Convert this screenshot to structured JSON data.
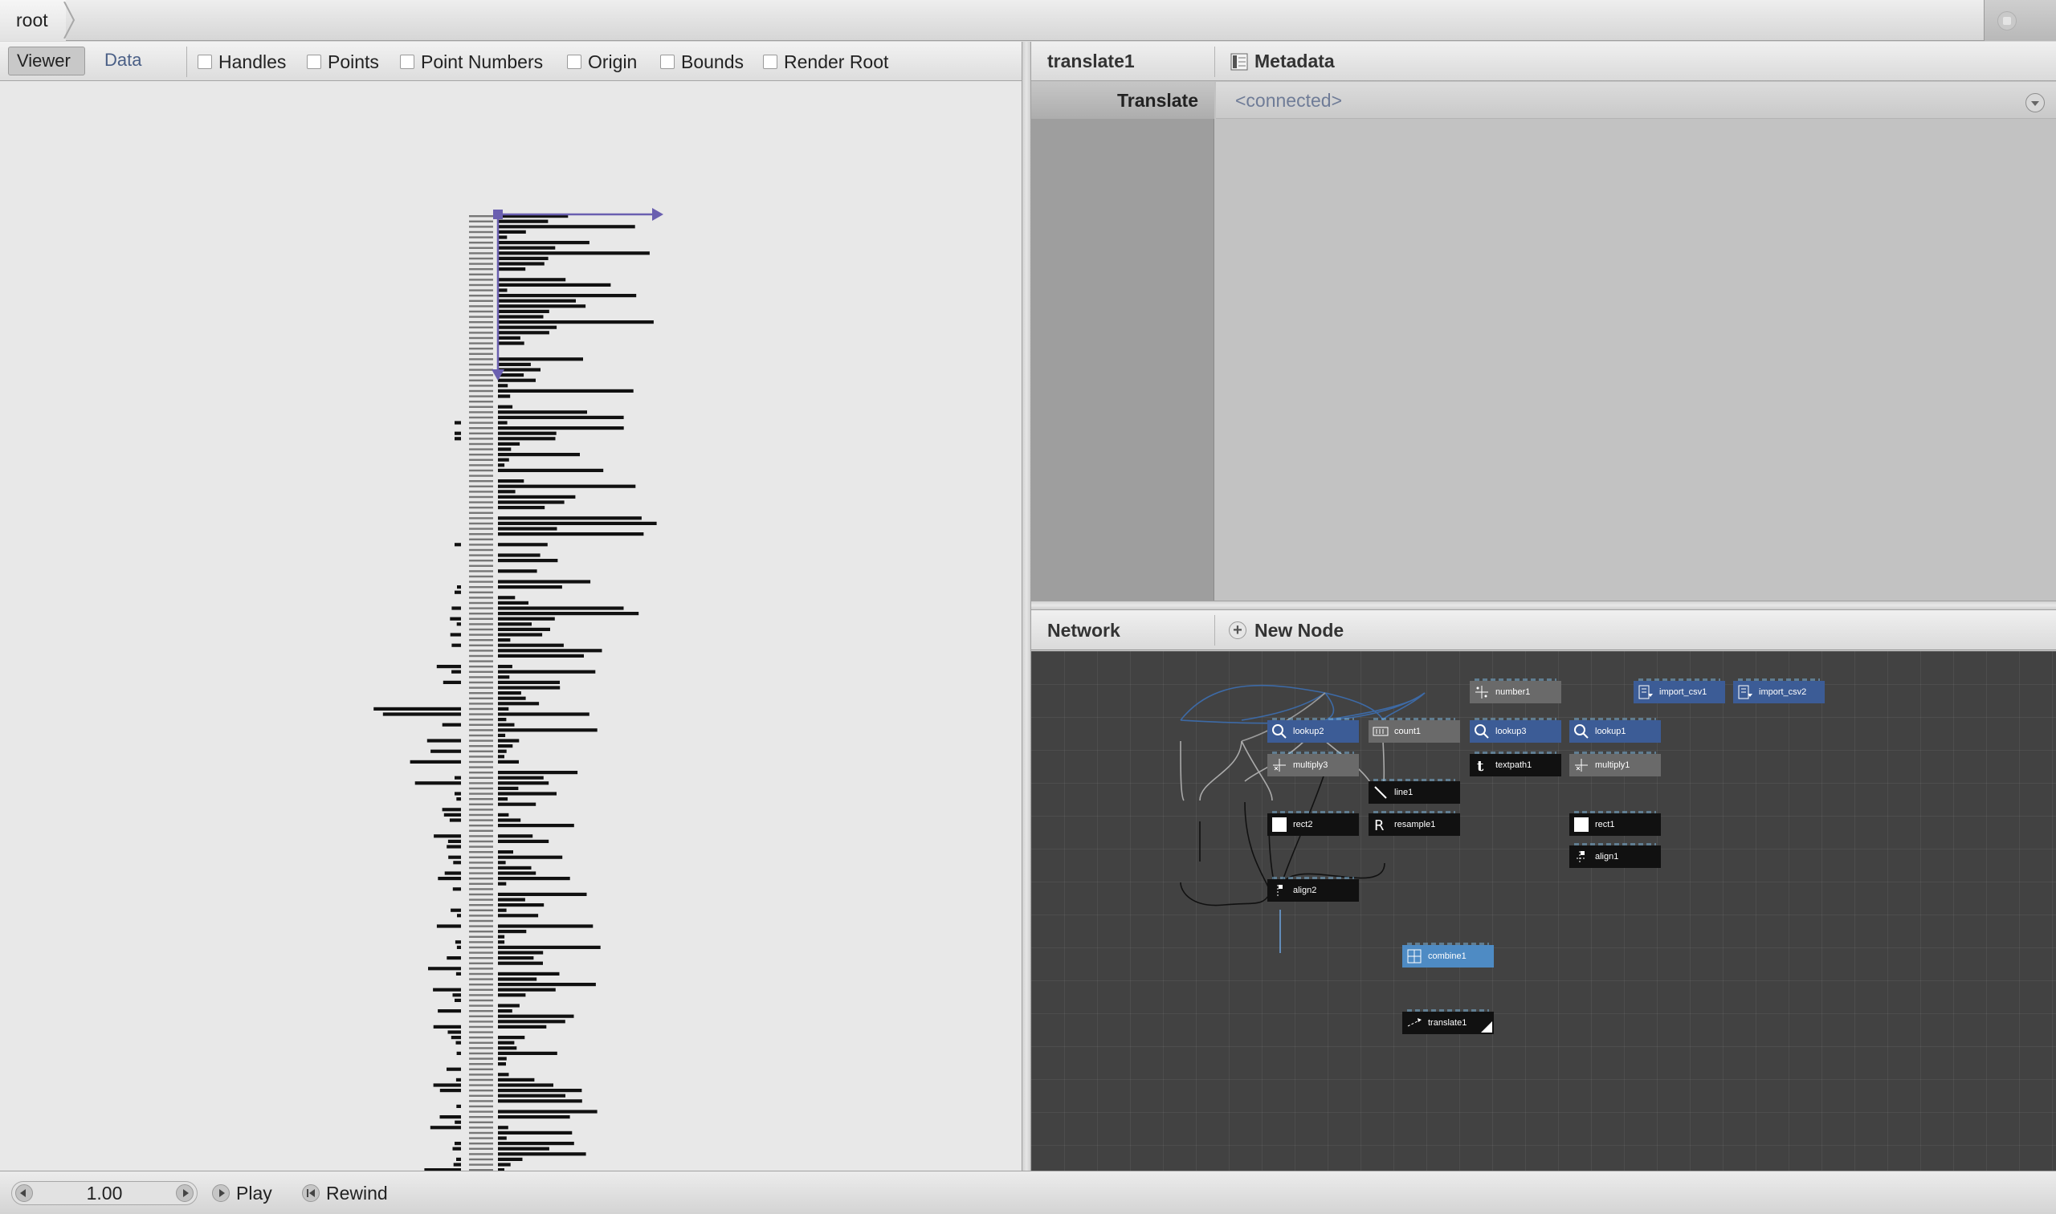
{
  "address_bar": {
    "root_label": "root"
  },
  "viewer_toolbar": {
    "tabs": [
      {
        "label": "Viewer",
        "active": true
      },
      {
        "label": "Data",
        "active": false
      }
    ],
    "checkboxes": [
      {
        "label": "Handles",
        "checked": true
      },
      {
        "label": "Points",
        "checked": false
      },
      {
        "label": "Point Numbers",
        "checked": false
      },
      {
        "label": "Origin",
        "checked": false
      },
      {
        "label": "Bounds",
        "checked": false
      },
      {
        "label": "Render Root",
        "checked": true
      }
    ]
  },
  "parameters": {
    "node_name": "translate1",
    "metadata_label": "Metadata",
    "rows": [
      {
        "label": "Translate",
        "value": "<connected>"
      }
    ]
  },
  "network": {
    "title": "Network",
    "new_node_label": "New Node",
    "nodes": [
      {
        "name": "number1",
        "type": "gray",
        "icon": "number-icon"
      },
      {
        "name": "import_csv1",
        "type": "blue",
        "icon": "import-csv-icon"
      },
      {
        "name": "import_csv2",
        "type": "blue",
        "icon": "import-csv-icon"
      },
      {
        "name": "lookup2",
        "type": "blue",
        "icon": "lookup-icon"
      },
      {
        "name": "count1",
        "type": "gray",
        "icon": "count-icon"
      },
      {
        "name": "lookup3",
        "type": "blue",
        "icon": "lookup-icon"
      },
      {
        "name": "lookup1",
        "type": "blue",
        "icon": "lookup-icon"
      },
      {
        "name": "multiply3",
        "type": "gray",
        "icon": "multiply-icon"
      },
      {
        "name": "textpath1",
        "type": "dark",
        "icon": "text-icon"
      },
      {
        "name": "multiply1",
        "type": "gray",
        "icon": "multiply-icon"
      },
      {
        "name": "line1",
        "type": "dark",
        "icon": "line-icon"
      },
      {
        "name": "rect2",
        "type": "dark",
        "icon": "rect-icon"
      },
      {
        "name": "resample1",
        "type": "dark",
        "icon": "resample-icon"
      },
      {
        "name": "rect1",
        "type": "dark",
        "icon": "rect-icon"
      },
      {
        "name": "align1",
        "type": "dark",
        "icon": "align-icon"
      },
      {
        "name": "align2",
        "type": "dark",
        "icon": "align-icon"
      },
      {
        "name": "combine1",
        "type": "selected",
        "icon": "combine-icon"
      },
      {
        "name": "translate1",
        "type": "dark",
        "icon": "translate-icon"
      }
    ]
  },
  "playback": {
    "frame": "1.00",
    "play_label": "Play",
    "rewind_label": "Rewind"
  },
  "colors": {
    "network_bg": "#424242",
    "node_blue": "#3c5c96",
    "node_gray": "#6a6a6a",
    "node_dark": "#111111",
    "node_selected": "#4e8bc4",
    "handle": "#6a5fb0",
    "connected_text": "#6f7c97"
  }
}
